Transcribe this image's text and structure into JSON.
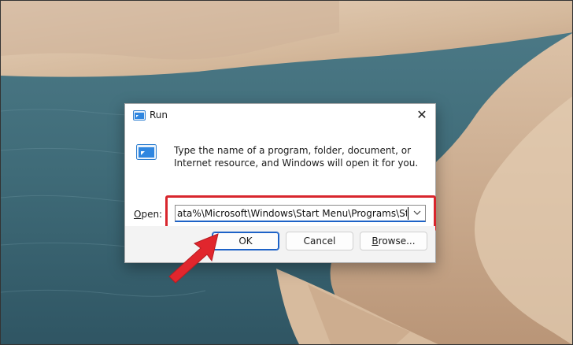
{
  "dialog": {
    "title": "Run",
    "close_glyph": "✕",
    "description": "Type the name of a program, folder, document, or Internet resource, and Windows will open it for you.",
    "open_label_accel": "O",
    "open_label_rest": "pen:",
    "open_value": "ata%\\Microsoft\\Windows\\Start Menu\\Programs\\Startup",
    "buttons": {
      "ok": "OK",
      "cancel": "Cancel",
      "browse_accel": "B",
      "browse_rest": "rowse..."
    }
  },
  "icons": {
    "title": "run-app-icon",
    "body": "run-app-icon",
    "dropdown": "chevron-down-icon",
    "annotation": "red-pointer-arrow"
  },
  "colors": {
    "accent": "#1d62c7",
    "highlight": "#d8262d",
    "footer_bg": "#f3f3f3"
  }
}
